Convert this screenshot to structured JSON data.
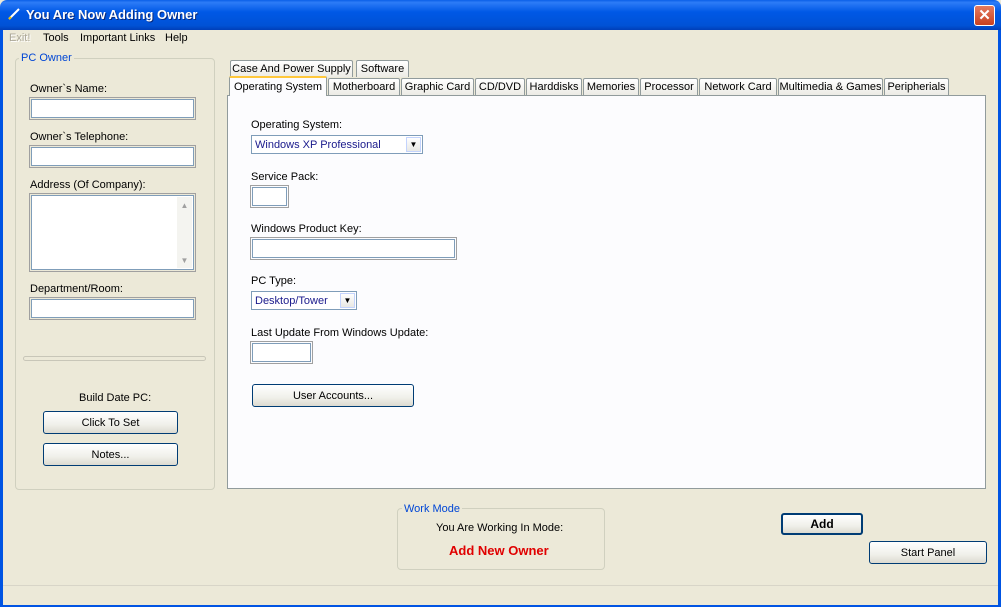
{
  "window": {
    "title": "You Are Now Adding Owner",
    "close_glyph": "✕"
  },
  "menu": {
    "exit": "Exit!",
    "tools": "Tools",
    "important_links": "Important Links",
    "help": "Help"
  },
  "owner_group": {
    "title": "PC Owner",
    "name_label": "Owner`s Name:",
    "name_value": "",
    "telephone_label": "Owner`s Telephone:",
    "telephone_value": "",
    "address_label": "Address (Of Company):",
    "address_value": "",
    "department_label": "Department/Room:",
    "department_value": "",
    "build_date_label": "Build Date PC:",
    "click_to_set": "Click To Set",
    "notes": "Notes..."
  },
  "tabs": {
    "row1": [
      "Case And Power Supply",
      "Software"
    ],
    "row2": [
      "Operating System",
      "Motherboard",
      "Graphic Card",
      "CD/DVD",
      "Harddisks",
      "Memories",
      "Processor",
      "Network Card",
      "Multimedia & Games",
      "Peripherials"
    ],
    "active": "Operating System"
  },
  "os_panel": {
    "os_label": "Operating System:",
    "os_value": "Windows XP Professional",
    "service_pack_label": "Service Pack:",
    "service_pack_value": "",
    "product_key_label": "Windows Product Key:",
    "product_key_value": "",
    "pc_type_label": "PC Type:",
    "pc_type_value": "Desktop/Tower",
    "last_update_label": "Last Update From Windows Update:",
    "last_update_value": "",
    "user_accounts": "User Accounts..."
  },
  "work_mode": {
    "title": "Work Mode",
    "caption": "You Are Working In Mode:",
    "mode": "Add New Owner",
    "mode_color": "#e00000"
  },
  "actions": {
    "add": "Add",
    "start_panel": "Start Panel"
  }
}
